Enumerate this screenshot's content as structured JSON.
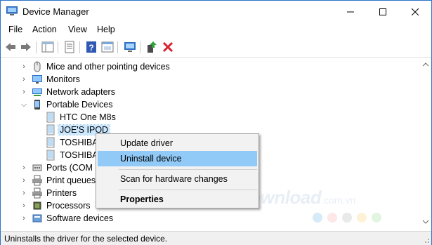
{
  "window": {
    "title": "Device Manager",
    "minimize_icon": "minimize-icon",
    "maximize_icon": "maximize-icon",
    "close_icon": "close-icon"
  },
  "menu": [
    "File",
    "Action",
    "View",
    "Help"
  ],
  "toolbar": [
    "back-arrow-icon",
    "forward-arrow-icon",
    "show-hide-tree-icon",
    "properties-icon",
    "help-icon",
    "view-icon",
    "monitor-scan-icon",
    "update-driver-icon",
    "uninstall-x-icon"
  ],
  "tree": [
    {
      "label": "Mice and other pointing devices",
      "icon": "mouse-icon",
      "chevron": "collapsed"
    },
    {
      "label": "Monitors",
      "icon": "monitor-icon",
      "chevron": "collapsed"
    },
    {
      "label": "Network adapters",
      "icon": "network-icon",
      "chevron": "collapsed"
    },
    {
      "label": "Portable Devices",
      "icon": "portable-device-icon",
      "chevron": "expanded"
    },
    {
      "label": "HTC One M8s",
      "icon": "device-icon",
      "child": true
    },
    {
      "label": "JOE'S IPOD",
      "icon": "device-icon",
      "child": true,
      "selected": true
    },
    {
      "label": "TOSHIBA",
      "icon": "device-icon",
      "child": true
    },
    {
      "label": "TOSHIBA",
      "icon": "device-icon",
      "child": true
    },
    {
      "label": "Ports (COM &",
      "icon": "port-icon",
      "chevron": "collapsed"
    },
    {
      "label": "Print queues",
      "icon": "printer-icon",
      "chevron": "collapsed"
    },
    {
      "label": "Printers",
      "icon": "printer-icon",
      "chevron": "collapsed"
    },
    {
      "label": "Processors",
      "icon": "processor-icon",
      "chevron": "collapsed"
    },
    {
      "label": "Software devices",
      "icon": "software-icon",
      "chevron": "collapsed"
    }
  ],
  "context_menu": {
    "items": [
      "Update driver",
      "Uninstall device",
      "Scan for hardware changes",
      "Properties"
    ],
    "highlighted": "Uninstall device"
  },
  "status": "Uninstalls the driver for the selected device.",
  "watermark": {
    "main": "Download",
    "suffix": ".com.vn"
  },
  "colors": {
    "accent": "#2b73c9",
    "selection": "#cce8ff",
    "menu_highlight": "#91c9f7",
    "watermark_dots": [
      "#d6eaf8",
      "#fde7e7",
      "#e9e9e9",
      "#fff1d6",
      "#e2f5e1"
    ]
  }
}
